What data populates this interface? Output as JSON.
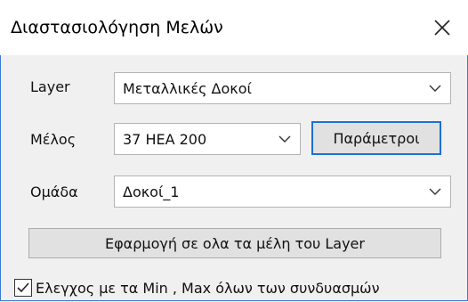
{
  "window": {
    "title": "Διαστασιολόγηση Μελών"
  },
  "form": {
    "layer": {
      "label": "Layer",
      "value": "Μεταλλικές Δοκοί"
    },
    "member": {
      "label": "Μέλος",
      "value": "37 HEA 200"
    },
    "parameters_button": "Παράμετροι",
    "group": {
      "label": "Ομάδα",
      "value": "Δοκοί_1"
    },
    "apply_all_button": "Εφαρμογή σε ολα τα μέλη του Layer",
    "check_minmax": {
      "label": "Ελεγχος με τα Min , Max όλων των συνδυασμών",
      "checked": true
    }
  },
  "icons": {
    "close": "close-icon",
    "dropdown": "chevron-down-icon",
    "check": "checkmark-icon"
  },
  "colors": {
    "accent_border": "#3a78d8",
    "default_button_border": "#1e6fd9",
    "dialog_bg": "#f0f0f0"
  }
}
